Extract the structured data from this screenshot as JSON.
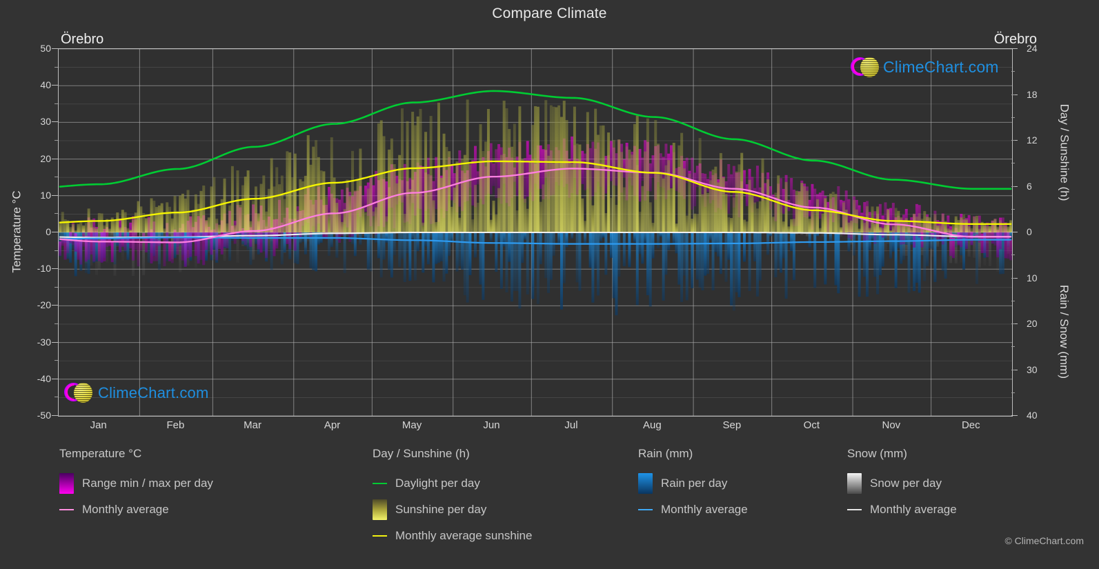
{
  "header": {
    "title": "Compare Climate",
    "station_left": "Örebro",
    "station_right": "Örebro"
  },
  "watermark": {
    "text": "ClimeChart.com",
    "copyright": "© ClimeChart.com"
  },
  "axes": {
    "left_label": "Temperature °C",
    "right_label_top": "Day / Sunshine (h)",
    "right_label_bottom": "Rain / Snow (mm)",
    "left_ticks": [
      "50",
      "40",
      "30",
      "20",
      "10",
      "0",
      "-10",
      "-20",
      "-30",
      "-40",
      "-50"
    ],
    "right_ticks_top": [
      "24",
      "18",
      "12",
      "6",
      "0"
    ],
    "right_ticks_bottom": [
      "10",
      "20",
      "30",
      "40"
    ],
    "x_ticks": [
      "Jan",
      "Feb",
      "Mar",
      "Apr",
      "May",
      "Jun",
      "Jul",
      "Aug",
      "Sep",
      "Oct",
      "Nov",
      "Dec"
    ]
  },
  "legend": {
    "temperature": {
      "heading": "Temperature °C",
      "items": [
        {
          "label": "Range min / max per day",
          "type": "swatch",
          "color": "#ff00e6"
        },
        {
          "label": "Monthly average",
          "type": "line",
          "color": "#ff8fe0"
        }
      ]
    },
    "day_sunshine": {
      "heading": "Day / Sunshine (h)",
      "items": [
        {
          "label": "Daylight per day",
          "type": "line",
          "color": "#00cc33"
        },
        {
          "label": "Sunshine per day",
          "type": "swatch",
          "color": "#eded5c"
        },
        {
          "label": "Monthly average sunshine",
          "type": "line",
          "color": "#f2f211"
        }
      ]
    },
    "rain": {
      "heading": "Rain (mm)",
      "items": [
        {
          "label": "Rain per day",
          "type": "swatch",
          "color": "#1188e0"
        },
        {
          "label": "Monthly average",
          "type": "line",
          "color": "#3fa9f5"
        }
      ]
    },
    "snow": {
      "heading": "Snow (mm)",
      "items": [
        {
          "label": "Snow per day",
          "type": "swatch",
          "color": "#e9e9e9"
        },
        {
          "label": "Monthly average",
          "type": "line",
          "color": "#e6e6e6"
        }
      ]
    }
  },
  "chart_data": {
    "type": "line",
    "title": "Compare Climate",
    "subtitle": "Örebro",
    "xlabel": "",
    "ylabel": "Temperature °C",
    "ylabel_right_top": "Day / Sunshine (h)",
    "ylabel_right_bottom": "Rain / Snow (mm)",
    "ylim": [
      -50,
      50
    ],
    "ylim_right_top": [
      0,
      24
    ],
    "ylim_right_bottom": [
      0,
      40
    ],
    "grid": true,
    "legend_position": "below",
    "categories": [
      "Jan",
      "Feb",
      "Mar",
      "Apr",
      "May",
      "Jun",
      "Jul",
      "Aug",
      "Sep",
      "Oct",
      "Nov",
      "Dec"
    ],
    "series": [
      {
        "name": "Daylight per day",
        "unit": "h",
        "color": "#00cc33",
        "axis": "right-top",
        "values": [
          6.3,
          8.3,
          11.2,
          14.2,
          17.0,
          18.5,
          17.6,
          15.1,
          12.2,
          9.4,
          6.9,
          5.7
        ]
      },
      {
        "name": "Monthly average sunshine",
        "unit": "h",
        "color": "#f2f211",
        "axis": "right-top",
        "values": [
          1.5,
          2.6,
          4.4,
          6.5,
          8.4,
          9.3,
          9.2,
          7.8,
          5.3,
          2.9,
          1.5,
          1.1
        ]
      },
      {
        "name": "Monthly average temperature",
        "unit": "°C",
        "color": "#ff8fe0",
        "axis": "left",
        "values": [
          -2.5,
          -2.7,
          0.4,
          5.2,
          10.8,
          15.2,
          17.4,
          16.3,
          11.9,
          6.8,
          2.2,
          -1.2
        ]
      },
      {
        "name": "Monthly average rain",
        "unit": "mm",
        "color": "#3fa9f5",
        "axis": "right-bottom",
        "values": [
          1.3,
          1.1,
          1.2,
          1.2,
          1.7,
          2.3,
          2.5,
          2.5,
          2.4,
          2.1,
          1.9,
          1.6
        ]
      },
      {
        "name": "Monthly average snow",
        "unit": "mm",
        "color": "#e6e6e6",
        "axis": "right-bottom",
        "values": [
          1.1,
          1.0,
          0.7,
          0.2,
          0.0,
          0.0,
          0.0,
          0.0,
          0.0,
          0.1,
          0.5,
          0.9
        ]
      },
      {
        "name": "Temperature range max per day",
        "unit": "°C",
        "color": "#ff00e6",
        "axis": "left",
        "values": [
          0.8,
          0.5,
          4.2,
          10.2,
          16.4,
          20.7,
          22.8,
          21.5,
          16.4,
          10.3,
          4.8,
          1.6
        ]
      },
      {
        "name": "Temperature range min per day",
        "unit": "°C",
        "color": "#8000a0",
        "axis": "left",
        "values": [
          -5.6,
          -6.0,
          -3.5,
          0.6,
          5.3,
          10.0,
          12.4,
          11.5,
          7.8,
          3.6,
          -0.3,
          -3.9
        ]
      },
      {
        "name": "Sunshine per day",
        "unit": "h",
        "color": "#eded5c",
        "axis": "right-top",
        "values": [
          1.5,
          2.6,
          4.4,
          6.5,
          8.4,
          9.3,
          9.2,
          7.8,
          5.3,
          2.9,
          1.5,
          1.1
        ]
      },
      {
        "name": "Rain per day",
        "unit": "mm",
        "color": "#1188e0",
        "axis": "right-bottom",
        "values": [
          1.3,
          1.1,
          1.2,
          1.2,
          1.7,
          2.3,
          2.5,
          2.5,
          2.4,
          2.1,
          1.9,
          1.6
        ]
      },
      {
        "name": "Snow per day",
        "unit": "mm",
        "color": "#e9e9e9",
        "axis": "right-bottom",
        "values": [
          1.1,
          1.0,
          0.7,
          0.2,
          0.0,
          0.0,
          0.0,
          0.0,
          0.0,
          0.1,
          0.5,
          0.9
        ]
      }
    ]
  }
}
